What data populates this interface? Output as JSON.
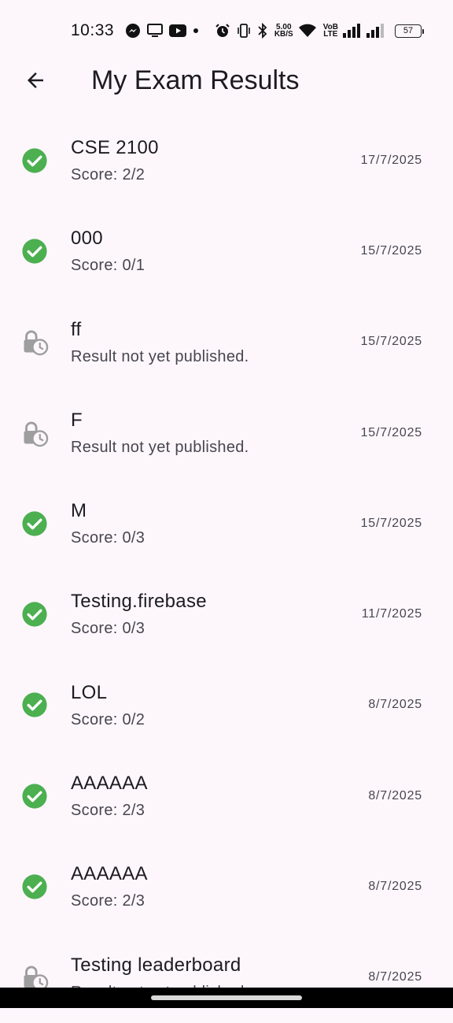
{
  "status": {
    "time": "10:33",
    "speed_top": "5.00",
    "speed_bottom": "KB/S",
    "volte_top": "VoB",
    "volte_bottom": "LTE",
    "battery": "57"
  },
  "header": {
    "title": "My Exam Results"
  },
  "colors": {
    "success": "#4caf50",
    "pending": "#9e9e9e",
    "background": "#fdf7fc"
  },
  "results": [
    {
      "title": "CSE 2100",
      "subtitle": "Score: 2/2",
      "date": "17/7/2025",
      "status_icon": "check-circle-icon"
    },
    {
      "title": "000",
      "subtitle": "Score: 0/1",
      "date": "15/7/2025",
      "status_icon": "check-circle-icon"
    },
    {
      "title": "ff",
      "subtitle": "Result not yet published.",
      "date": "15/7/2025",
      "status_icon": "lock-clock-icon"
    },
    {
      "title": "F",
      "subtitle": "Result not yet published.",
      "date": "15/7/2025",
      "status_icon": "lock-clock-icon"
    },
    {
      "title": "M",
      "subtitle": "Score: 0/3",
      "date": "15/7/2025",
      "status_icon": "check-circle-icon"
    },
    {
      "title": "Testing.firebase",
      "subtitle": "Score: 0/3",
      "date": "11/7/2025",
      "status_icon": "check-circle-icon"
    },
    {
      "title": "LOL",
      "subtitle": "Score: 0/2",
      "date": "8/7/2025",
      "status_icon": "check-circle-icon"
    },
    {
      "title": "AAAAAA",
      "subtitle": "Score: 2/3",
      "date": "8/7/2025",
      "status_icon": "check-circle-icon"
    },
    {
      "title": "AAAAAA",
      "subtitle": "Score: 2/3",
      "date": "8/7/2025",
      "status_icon": "check-circle-icon"
    },
    {
      "title": "Testing leaderboard",
      "subtitle": "Result not yet published.",
      "date": "8/7/2025",
      "status_icon": "lock-clock-icon"
    }
  ]
}
